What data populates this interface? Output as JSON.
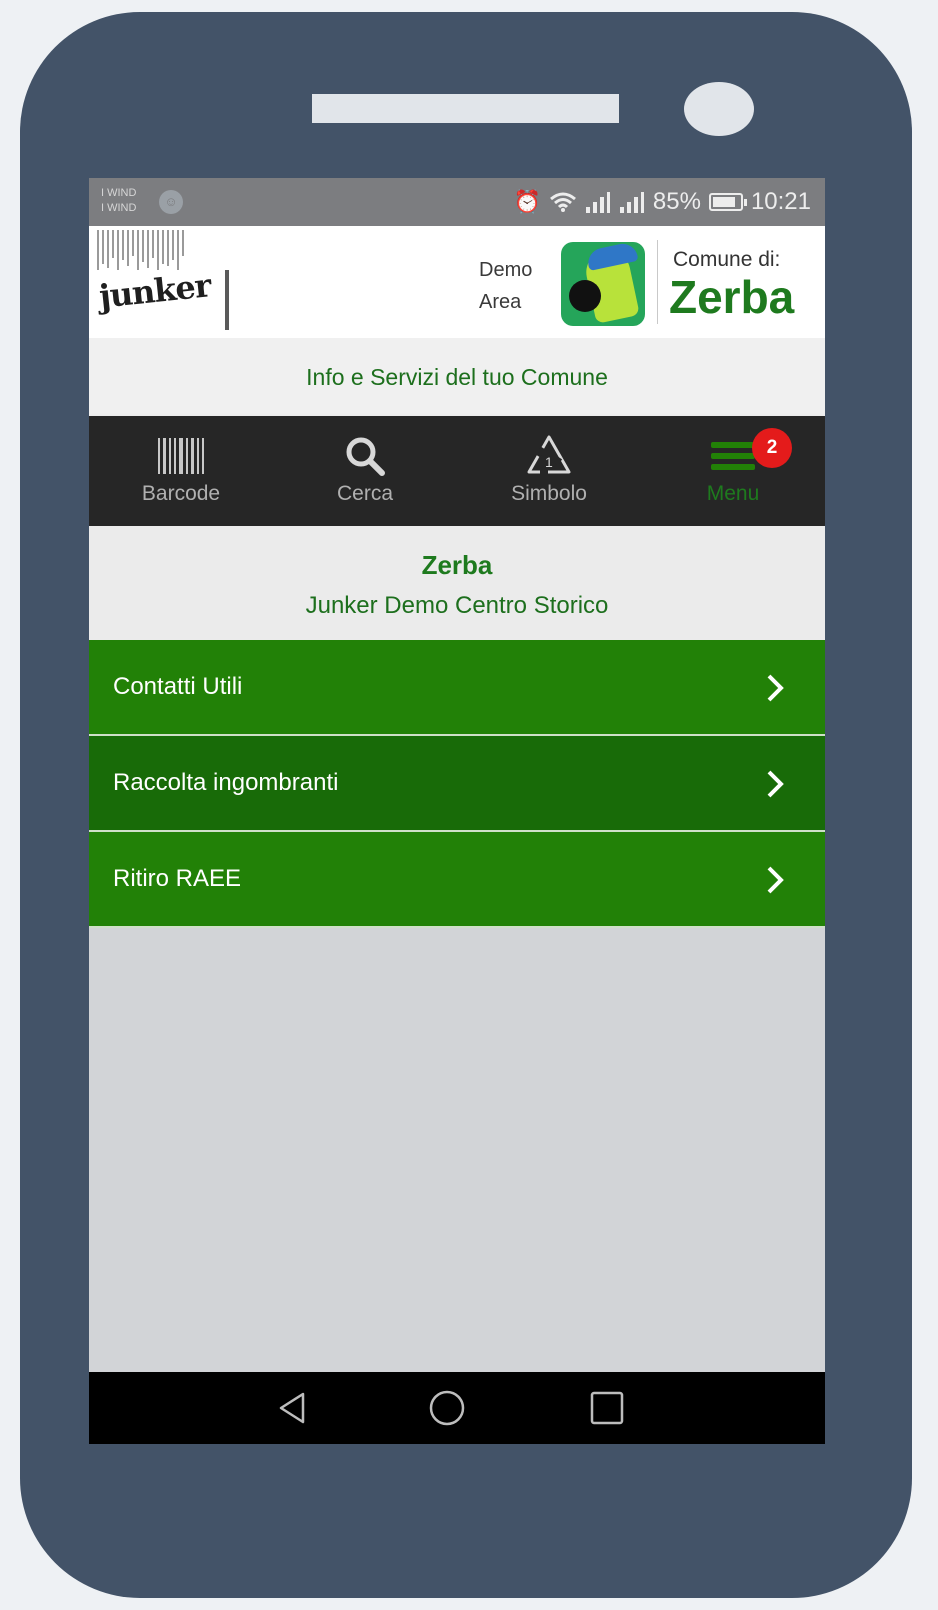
{
  "status_bar": {
    "carrier_line1": "I WIND",
    "carrier_line2": "I WIND",
    "battery": "85%",
    "time": "10:21",
    "icons": [
      "alarm-icon",
      "wifi-icon",
      "signal-icon",
      "signal-icon",
      "battery-icon"
    ]
  },
  "header": {
    "brand": "junker",
    "demo_line1": "Demo",
    "demo_line2": "Area",
    "comune_label": "Comune di:",
    "comune_name": "Zerba"
  },
  "subtitle": "Info e Servizi del tuo Comune",
  "tabs": [
    {
      "label": "Barcode",
      "icon": "barcode-icon"
    },
    {
      "label": "Cerca",
      "icon": "search-icon"
    },
    {
      "label": "Simbolo",
      "icon": "recycle-symbol-icon"
    },
    {
      "label": "Menu",
      "icon": "menu-icon",
      "badge": "2",
      "active": true
    }
  ],
  "location": {
    "city": "Zerba",
    "area": "Junker Demo Centro Storico"
  },
  "menu_items": [
    {
      "label": "Contatti Utili"
    },
    {
      "label": "Raccolta ingombranti"
    },
    {
      "label": "Ritiro RAEE"
    }
  ],
  "colors": {
    "brand_green": "#228107",
    "brand_green_dark": "#186b08",
    "badge_red": "#e41b1b",
    "phone_body": "#435368"
  }
}
